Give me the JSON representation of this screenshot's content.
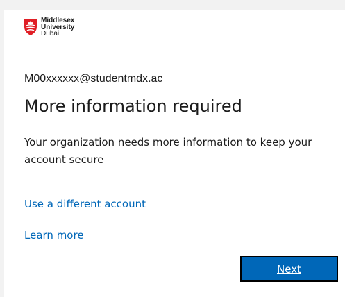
{
  "brand": {
    "name_line1": "Middlesex",
    "name_line2": "University",
    "name_line3": "Dubai",
    "logo_icon": "university-shield-icon",
    "accent_color": "#e01f26"
  },
  "account": {
    "identity": "M00xxxxxx@studentmdx.ac"
  },
  "main": {
    "title": "More information required",
    "description": "Your organization needs more information to keep your account secure"
  },
  "links": {
    "different_account": "Use a different account",
    "learn_more": "Learn more"
  },
  "actions": {
    "next_label": "Next",
    "primary_color": "#0067b8"
  }
}
